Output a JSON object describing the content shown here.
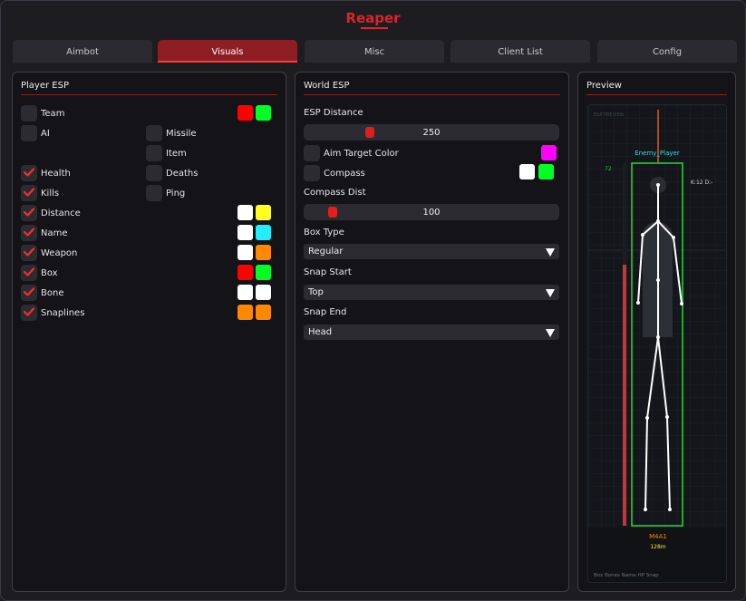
{
  "app": {
    "title": "Reaper"
  },
  "tabs": [
    {
      "label": "Aimbot",
      "active": false
    },
    {
      "label": "Visuals",
      "active": true
    },
    {
      "label": "Misc",
      "active": false
    },
    {
      "label": "Client List",
      "active": false
    },
    {
      "label": "Config",
      "active": false
    }
  ],
  "player_esp": {
    "title": "Player ESP",
    "items": [
      {
        "label": "Team",
        "checked": false,
        "colors": [
          "#ff0000",
          "#00ff22"
        ]
      },
      {
        "label": "AI",
        "checked": false,
        "colors": []
      },
      {
        "label": "Health",
        "checked": true,
        "colors": []
      },
      {
        "label": "Kills",
        "checked": true,
        "colors": []
      },
      {
        "label": "Distance",
        "checked": true,
        "colors": [
          "#ffffff",
          "#ffff22"
        ]
      },
      {
        "label": "Name",
        "checked": true,
        "colors": [
          "#ffffff",
          "#22eeff"
        ]
      },
      {
        "label": "Weapon",
        "checked": true,
        "colors": [
          "#ffffff",
          "#ff8800"
        ]
      },
      {
        "label": "Box",
        "checked": true,
        "colors": [
          "#ff0000",
          "#00ff22"
        ]
      },
      {
        "label": "Bone",
        "checked": true,
        "colors": [
          "#ffffff",
          "#ffffff"
        ]
      },
      {
        "label": "Snaplines",
        "checked": true,
        "colors": [
          "#ff8800",
          "#ff8800"
        ]
      }
    ],
    "right_items": [
      {
        "label": "Missile",
        "checked": false
      },
      {
        "label": "Item",
        "checked": false
      },
      {
        "label": "Deaths",
        "checked": false
      },
      {
        "label": "Ping",
        "checked": false
      }
    ]
  },
  "world_esp": {
    "title": "World ESP",
    "esp_distance": {
      "label": "ESP Distance",
      "value": "250",
      "fraction": 0.25
    },
    "aim_target_color": {
      "label": "Aim Target Color",
      "checked": false,
      "colors": [
        "#ff00ff"
      ]
    },
    "compass": {
      "label": "Compass",
      "checked": false,
      "colors": [
        "#ffffff",
        "#00ff22"
      ]
    },
    "compass_dist": {
      "label": "Compass Dist",
      "value": "100",
      "fraction": 0.1
    },
    "box_type": {
      "label": "Box Type",
      "value": "Regular"
    },
    "snap_start": {
      "label": "Snap Start",
      "value": "Top"
    },
    "snap_end": {
      "label": "Snap End",
      "value": "Head"
    }
  },
  "preview": {
    "title": "Preview",
    "corner_label": "ESP PREVIEW",
    "name_tag": "Enemy_Player",
    "hp_text": "72",
    "hp_fraction": 0.72,
    "kd_text": "K:12  D:-",
    "weapon": "M4A1",
    "distance": "128m",
    "legend": "Box  Bones  Name  HP  Snap",
    "colors": {
      "box": "#22dd33",
      "bone": "#ffffff",
      "snapline": "#dd5a1a",
      "name": "#33dddd",
      "weapon": "#ff8800",
      "distance": "#ffee22",
      "hp": "#22cc44",
      "hp_low": "#cc3333"
    }
  }
}
